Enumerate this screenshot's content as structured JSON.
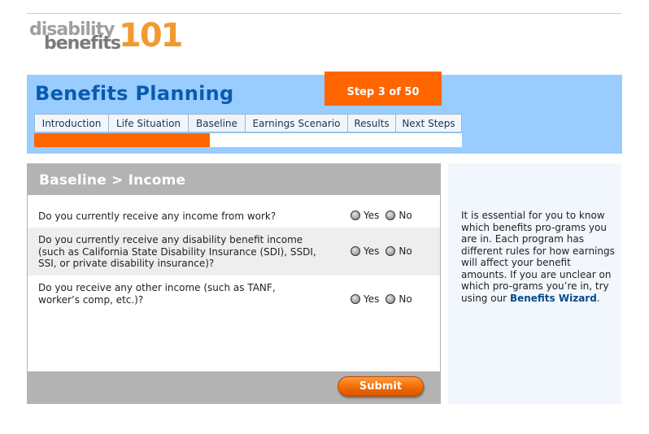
{
  "logo": {
    "word1": "disability",
    "word2": "benefits",
    "number": "101"
  },
  "header": {
    "title": "Benefits Planning",
    "step": "Step 3 of 50"
  },
  "tabs": [
    {
      "label": "Introduction"
    },
    {
      "label": "Life Situation"
    },
    {
      "label": "Baseline"
    },
    {
      "label": "Earnings Scenario"
    },
    {
      "label": "Results"
    },
    {
      "label": "Next Steps"
    }
  ],
  "progress": {
    "fraction": 0.41
  },
  "panel": {
    "title": "Baseline > Income",
    "questions": [
      {
        "text": "Do you currently receive any income from work?",
        "yes": "Yes",
        "no": "No"
      },
      {
        "text": "Do you currently receive any disability benefit income (such as California State Disability Insurance (SDI), SSDI, SSI, or private disability insurance)?",
        "yes": "Yes",
        "no": "No"
      },
      {
        "text": "Do you receive any other income (such as TANF, worker’s comp, etc.)?",
        "yes": "Yes",
        "no": "No"
      }
    ],
    "submit_label": "Submit"
  },
  "sidebar": {
    "text": "It is essential for you to know which benefits pro-grams you are in. Each program has different rules for how earnings will affect your benefit amounts. If you are unclear on which pro-grams you’re in, try using our",
    "link": "Benefits Wizard",
    "trailing": "."
  },
  "colors": {
    "accent": "#ff6600",
    "header_bg": "#99ccff",
    "title": "#0a5bb0",
    "panel_gray": "#b3b3b3"
  }
}
